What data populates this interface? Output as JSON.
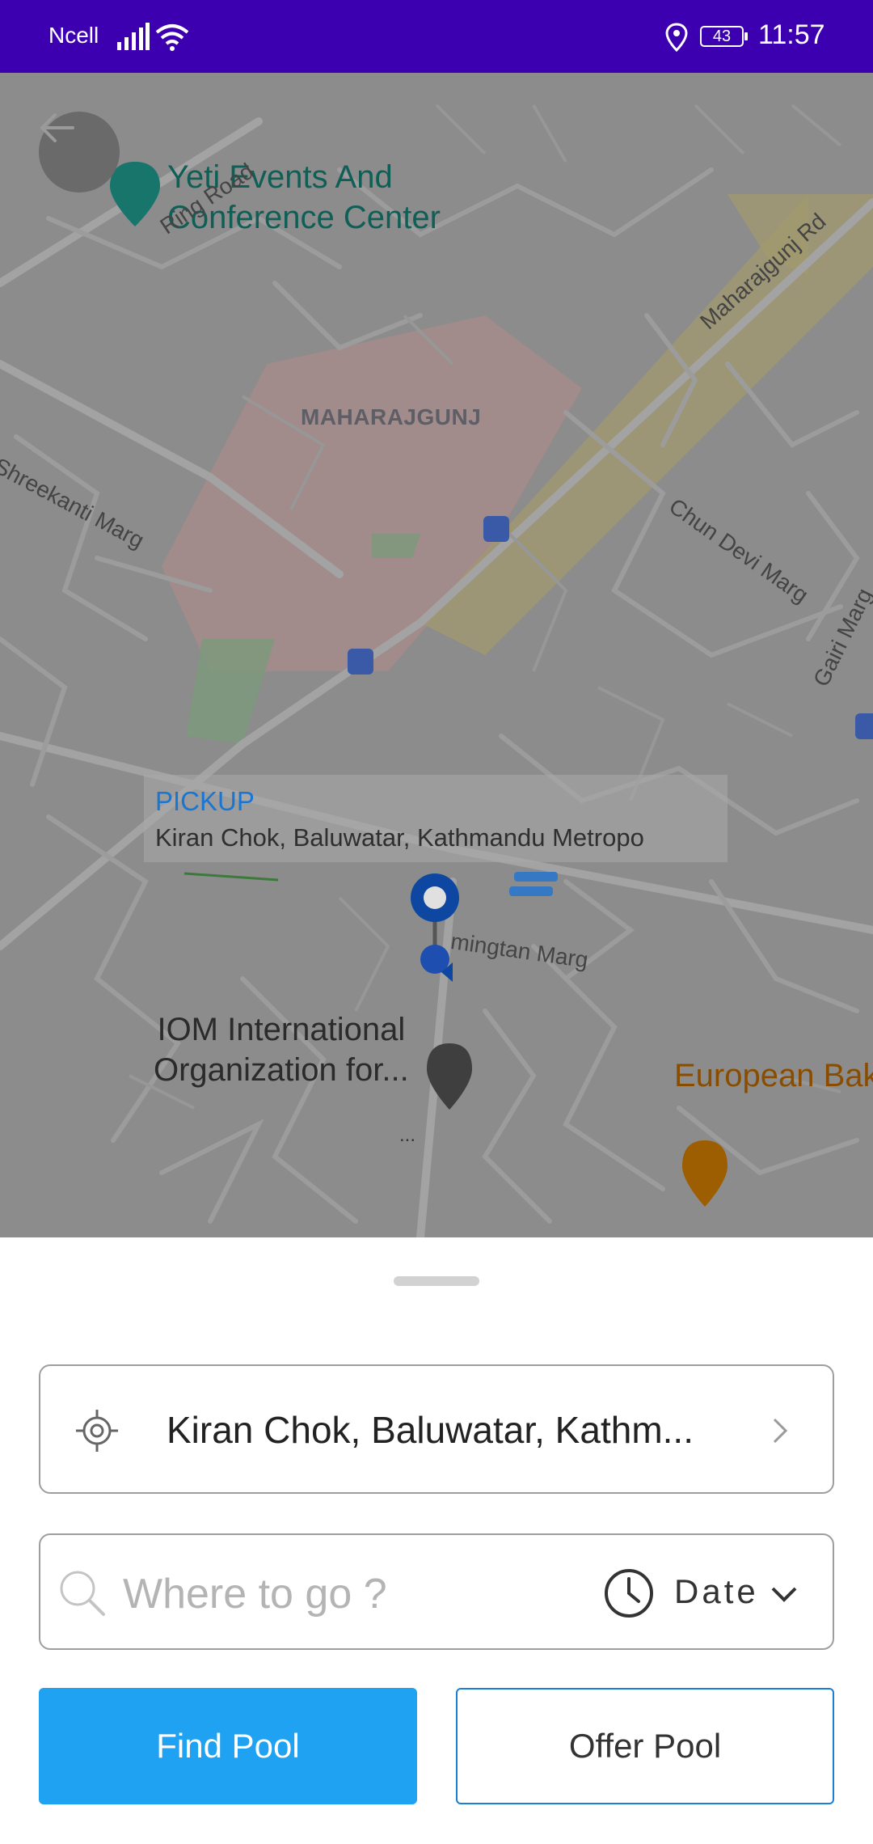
{
  "status_bar": {
    "carrier": "Ncell",
    "battery": "43",
    "time": "11:57"
  },
  "map": {
    "poi_yeti": [
      "Yeti Events And",
      "Conference Center"
    ],
    "area_label": "MAHARAJGUNJ",
    "roads": {
      "ring_road": "Ring Road",
      "shreekanti": "Shreekanti Marg",
      "maharajgunj_rd": "Maharajgunj Rd",
      "chun_devi": "Chun Devi Marg",
      "gairi": "Gairi Marg",
      "mingtan": "mingtan Marg"
    },
    "pickup": {
      "title": "PICKUP",
      "address": "Kiran Chok, Baluwatar, Kathmandu Metropo"
    },
    "poi_iom": [
      "IOM International",
      "Organization for..."
    ],
    "poi_european": "European Bak",
    "ellipsis": "..."
  },
  "sheet": {
    "pickup_value": "Kiran Chok, Baluwatar, Kathm...",
    "destination_placeholder": "Where to go ?",
    "date_label": "Date",
    "find_pool": "Find Pool",
    "offer_pool": "Offer Pool"
  },
  "colors": {
    "status_bar": "#3d00b0",
    "primary_button": "#1ea2f1",
    "pickup_title": "#1976d2"
  }
}
